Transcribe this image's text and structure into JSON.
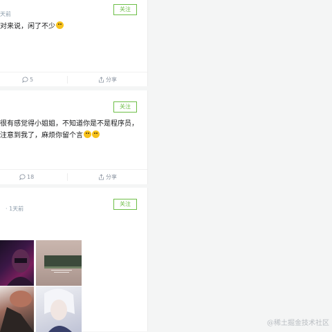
{
  "feed": {
    "posts": [
      {
        "time_fragment": "天前",
        "follow_label": "关注",
        "content_lines": [
          "对来说，闲了不少"
        ],
        "comment_count": "5",
        "share_label": "分享"
      },
      {
        "follow_label": "关注",
        "content_lines": [
          "很有感觉得小姐姐，不知道你是不是程序员，",
          "注意到我了，麻烦你留个言"
        ],
        "comment_count": "18",
        "share_label": "分享"
      },
      {
        "time_fragment": "· 1天前",
        "follow_label": "关注"
      }
    ]
  },
  "watermark": "@稀土掘金技术社区",
  "icons": {
    "comment": "comment-icon",
    "share": "share-icon",
    "emoji": "smile-emoji-icon",
    "laugh": "laugh-emoji-icon"
  }
}
